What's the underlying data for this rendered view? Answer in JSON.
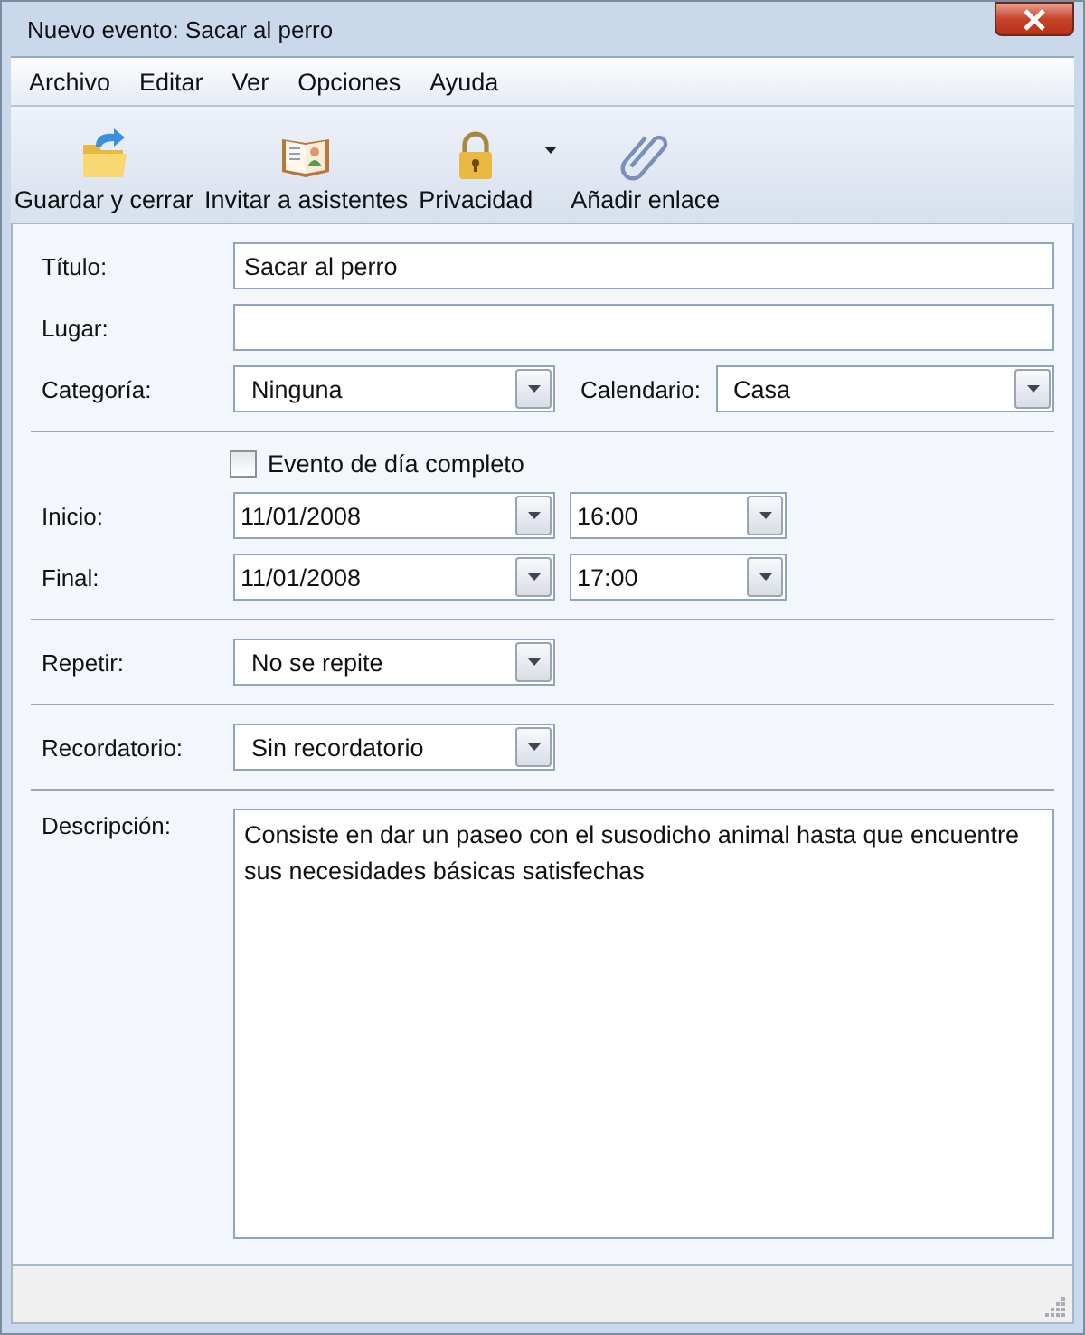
{
  "window": {
    "title": "Nuevo evento: Sacar al perro"
  },
  "menu": [
    "Archivo",
    "Editar",
    "Ver",
    "Opciones",
    "Ayuda"
  ],
  "toolbar": [
    {
      "label": "Guardar y cerrar",
      "kind": "save"
    },
    {
      "label": "Invitar a asistentes",
      "kind": "invite"
    },
    {
      "label": "Privacidad",
      "kind": "privacy",
      "has_menu": true
    },
    {
      "label": "Añadir enlace",
      "kind": "link"
    }
  ],
  "title_field": {
    "label": "Título:",
    "value": "Sacar al perro"
  },
  "location_field": {
    "label": "Lugar:"
  },
  "category": {
    "label": "Categoría:",
    "value": "Ninguna"
  },
  "calendar": {
    "label": "Calendario:",
    "value": "Casa"
  },
  "all_day": {
    "label": "Evento de día completo",
    "checked": false
  },
  "times": [
    {
      "label": "Inicio:",
      "date": "11/01/2008",
      "time": "16:00"
    },
    {
      "label": "Final:",
      "date": "11/01/2008",
      "time": "17:00"
    }
  ],
  "repeat": {
    "label": "Repetir:",
    "value": "No se repite"
  },
  "reminder": {
    "label": "Recordatorio:",
    "value": "Sin recordatorio"
  },
  "description": {
    "label": "Descripción:",
    "value": "Consiste en dar un paseo con el susodicho animal hasta que encuentre sus necesidades básicas satisfechas"
  }
}
